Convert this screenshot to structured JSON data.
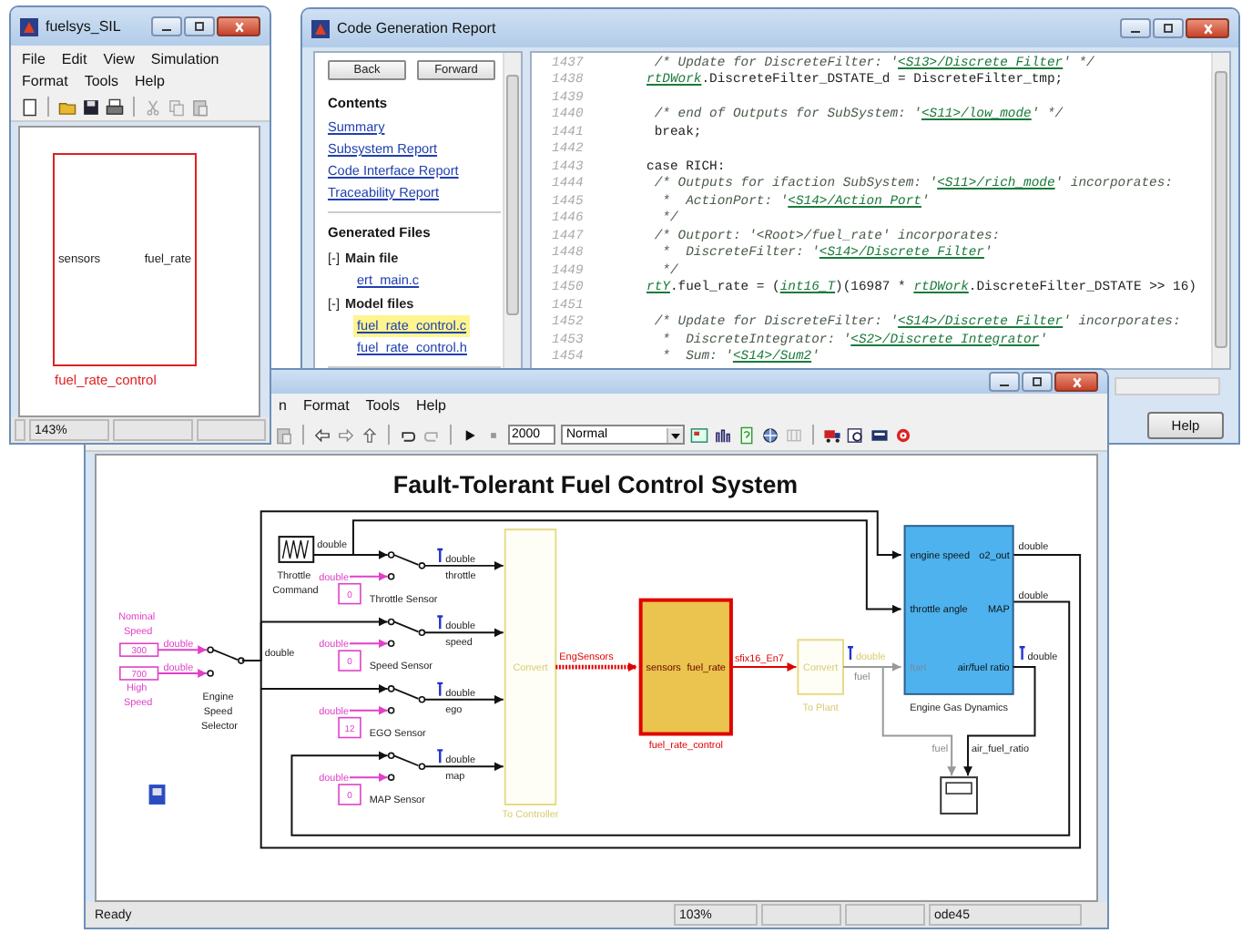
{
  "report_window": {
    "title": "Code Generation Report",
    "nav_buttons": [
      "Back",
      "Forward"
    ],
    "contents_heading": "Contents",
    "contents_links": [
      "Summary",
      "Subsystem Report",
      "Code Interface Report",
      "Traceability Report"
    ],
    "files_heading": "Generated Files",
    "file_groups": [
      {
        "toggle": "[-]",
        "label": "Main file",
        "files": [
          {
            "name": "ert_main.c",
            "selected": false
          }
        ]
      },
      {
        "toggle": "[-]",
        "label": "Model files",
        "files": [
          {
            "name": "fuel_rate_control.c",
            "selected": true
          },
          {
            "name": "fuel_rate_control.h",
            "selected": false
          }
        ]
      }
    ],
    "code_lines": [
      {
        "number": "1437",
        "segments": [
          {
            "kind": "comment",
            "text": " /* Update for DiscreteFilter: '"
          },
          {
            "kind": "link",
            "text": "<S13>/Discrete Filter"
          },
          {
            "kind": "comment",
            "text": "' */"
          }
        ]
      },
      {
        "number": "1438",
        "segments": [
          {
            "kind": "link",
            "text": "rtDWork"
          },
          {
            "kind": "code",
            "text": ".DiscreteFilter_DSTATE_d = DiscreteFilter_tmp;"
          }
        ]
      },
      {
        "number": "1439"
      },
      {
        "number": "1440",
        "segments": [
          {
            "kind": "comment",
            "text": " /* end of Outputs for SubSystem: '"
          },
          {
            "kind": "link",
            "text": "<S11>/low_mode"
          },
          {
            "kind": "comment",
            "text": "' */"
          }
        ]
      },
      {
        "number": "1441",
        "segments": [
          {
            "kind": "code",
            "text": " break;"
          }
        ]
      },
      {
        "number": "1442"
      },
      {
        "number": "1443",
        "segments": [
          {
            "kind": "code",
            "text": "case RICH:"
          }
        ]
      },
      {
        "number": "1444",
        "segments": [
          {
            "kind": "comment",
            "text": " /* Outputs for ifaction SubSystem: '"
          },
          {
            "kind": "link",
            "text": "<S11>/rich_mode"
          },
          {
            "kind": "comment",
            "text": "' incorporates:"
          }
        ]
      },
      {
        "number": "1445",
        "segments": [
          {
            "kind": "comment",
            "text": "  *  ActionPort: '"
          },
          {
            "kind": "link",
            "text": "<S14>/Action Port"
          },
          {
            "kind": "comment",
            "text": "'"
          }
        ]
      },
      {
        "number": "1446",
        "segments": [
          {
            "kind": "comment",
            "text": "  */"
          }
        ]
      },
      {
        "number": "1447",
        "segments": [
          {
            "kind": "comment",
            "text": " /* Outport: '<Root>/fuel_rate' incorporates:"
          }
        ]
      },
      {
        "number": "1448",
        "segments": [
          {
            "kind": "comment",
            "text": "  *  DiscreteFilter: '"
          },
          {
            "kind": "link",
            "text": "<S14>/Discrete Filter"
          },
          {
            "kind": "comment",
            "text": "'"
          }
        ]
      },
      {
        "number": "1449",
        "segments": [
          {
            "kind": "comment",
            "text": "  */"
          }
        ]
      },
      {
        "number": "1450",
        "segments": [
          {
            "kind": "link",
            "text": "rtY"
          },
          {
            "kind": "code",
            "text": ".fuel_rate = ("
          },
          {
            "kind": "link",
            "text": "int16_T"
          },
          {
            "kind": "code",
            "text": ")(16987 * "
          },
          {
            "kind": "link",
            "text": "rtDWork"
          },
          {
            "kind": "code",
            "text": ".DiscreteFilter_DSTATE >> 16)"
          }
        ]
      },
      {
        "number": "1451"
      },
      {
        "number": "1452",
        "segments": [
          {
            "kind": "comment",
            "text": " /* Update for DiscreteFilter: '"
          },
          {
            "kind": "link",
            "text": "<S14>/Discrete Filter"
          },
          {
            "kind": "comment",
            "text": "' incorporates:"
          }
        ]
      },
      {
        "number": "1453",
        "segments": [
          {
            "kind": "comment",
            "text": "  *  DiscreteIntegrator: '"
          },
          {
            "kind": "link",
            "text": "<S2>/Discrete Integrator"
          },
          {
            "kind": "comment",
            "text": "'"
          }
        ]
      },
      {
        "number": "1454",
        "segments": [
          {
            "kind": "comment",
            "text": "  *  Sum: '"
          },
          {
            "kind": "link",
            "text": "<S14>/Sum2"
          },
          {
            "kind": "comment",
            "text": "'"
          }
        ]
      }
    ],
    "buttons": [
      "Help"
    ]
  },
  "model_window": {
    "menu": [
      "n",
      "Format",
      "Tools",
      "Help"
    ],
    "stop_time": "2000",
    "sim_mode": "Normal",
    "diagram": {
      "title": "Fault-Tolerant Fuel Control System",
      "speed_constants": [
        {
          "value": "300",
          "label": "Nominal Speed",
          "type": "double"
        },
        {
          "value": "700",
          "label": "High Speed",
          "type": "double"
        }
      ],
      "selector": {
        "label": "Engine Speed Selector",
        "out_type": "double"
      },
      "throttle_command": {
        "label": "Throttle Command",
        "out_type": "double"
      },
      "sensors": [
        {
          "value": "0",
          "type": "double",
          "label": "Throttle Sensor",
          "out_type": "double",
          "signal": "throttle"
        },
        {
          "value": "0",
          "type": "double",
          "label": "Speed Sensor",
          "out_type": "double",
          "signal": "speed"
        },
        {
          "value": "12",
          "type": "double",
          "label": "EGO Sensor",
          "out_type": "double",
          "signal": "ego"
        },
        {
          "value": "0",
          "type": "double",
          "label": "MAP Sensor",
          "out_type": "double",
          "signal": "map"
        }
      ],
      "to_controller": {
        "text": "Convert",
        "label": "To Controller"
      },
      "bus_label": "EngSensors",
      "controller": {
        "input": "sensors",
        "output": "fuel_rate",
        "label": "fuel_rate_control",
        "out_signal": "sfix16_En7"
      },
      "to_plant": {
        "text": "Convert",
        "label": "To Plant",
        "out_type": "double",
        "out_signal": "fuel"
      },
      "plant": {
        "label": "Engine Gas Dynamics",
        "ports": [
          {
            "in": "engine speed",
            "out": "o2_out",
            "out_type": "double"
          },
          {
            "in": "throttle angle",
            "out": "MAP",
            "out_type": "double"
          },
          {
            "in": "fuel",
            "out": "air/fuel ratio",
            "out_type": "double"
          }
        ]
      },
      "scope_signals": [
        "fuel",
        "air_fuel_ratio"
      ]
    },
    "status": {
      "message": "Ready",
      "zoom": "103%",
      "solver": "ode45"
    }
  },
  "subsystem_window": {
    "title": "fuelsys_SIL",
    "menu": [
      "File",
      "Edit",
      "View",
      "Simulation",
      "Format",
      "Tools",
      "Help"
    ],
    "block": {
      "input": "sensors",
      "output": "fuel_rate",
      "label": "fuel_rate_control"
    },
    "zoom": "143%"
  }
}
